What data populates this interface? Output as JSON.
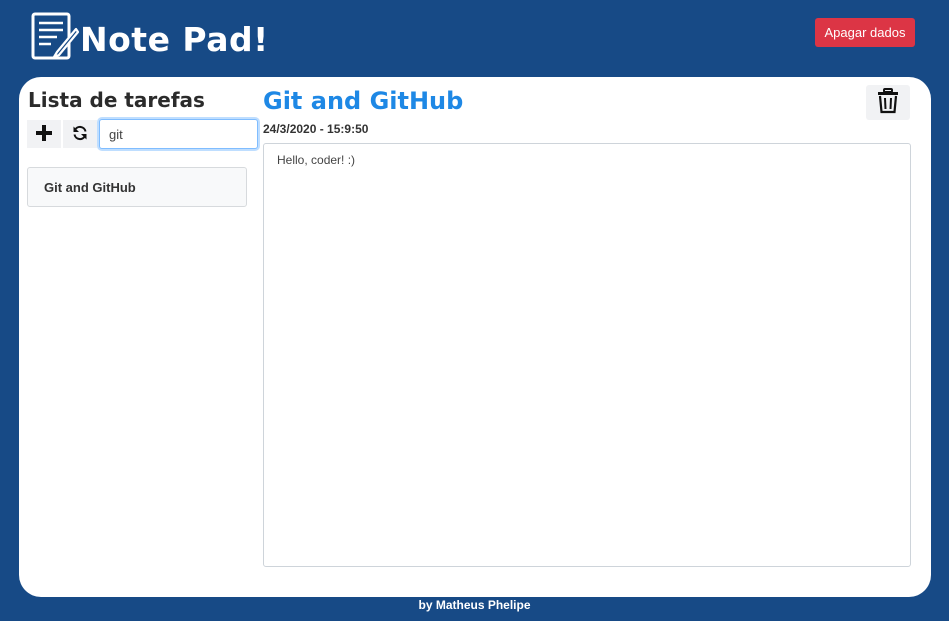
{
  "header": {
    "app_title": "Note Pad!",
    "clear_data_label": "Apagar dados",
    "logo_icon": "notepad-pencil-icon"
  },
  "sidebar": {
    "title": "Lista de tarefas",
    "add_icon": "plus-icon",
    "refresh_icon": "sync-icon",
    "search": {
      "value": "git",
      "placeholder": ""
    },
    "items": [
      {
        "label": "Git and GitHub"
      }
    ]
  },
  "note": {
    "title": "Git and GitHub",
    "date": "24/3/2020 - 15:9:50",
    "body": "Hello, coder! :)",
    "delete_icon": "trash-icon"
  },
  "footer": {
    "credit": "by Matheus Phelipe"
  },
  "colors": {
    "background": "#174a86",
    "danger": "#dc3545",
    "accent": "#1e88e5"
  }
}
